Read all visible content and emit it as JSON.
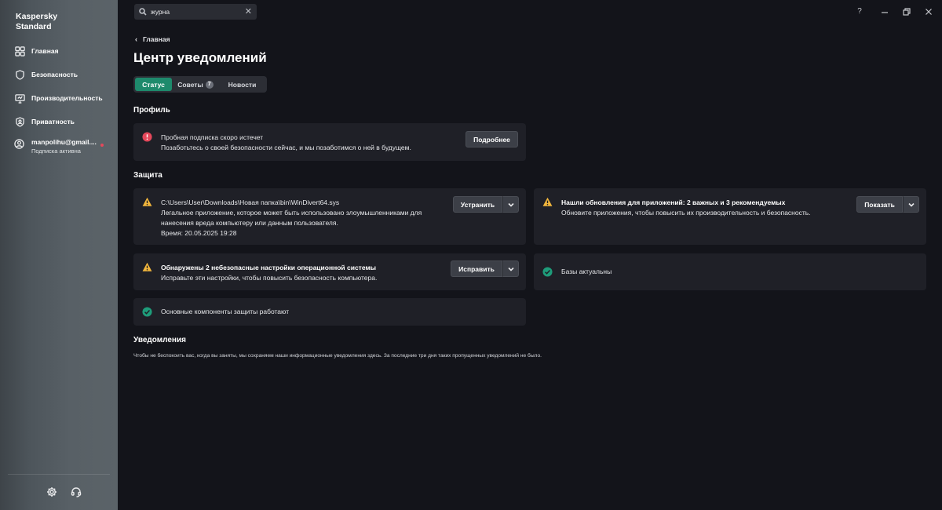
{
  "app": {
    "brand": "Kaspersky\nStandard"
  },
  "sidebar": {
    "items": [
      {
        "label": "Главная",
        "icon": "grid-icon"
      },
      {
        "label": "Безопасность",
        "icon": "shield-icon"
      },
      {
        "label": "Производительность",
        "icon": "monitor-icon"
      },
      {
        "label": "Приватность",
        "icon": "privacy-shield-icon"
      }
    ],
    "account": {
      "email": "manpolihu@gmail....",
      "status": "Подписка активна"
    }
  },
  "search": {
    "value": "журна",
    "placeholder": ""
  },
  "breadcrumb": {
    "label": "Главная"
  },
  "page": {
    "title": "Центр уведомлений"
  },
  "tabs": [
    {
      "label": "Статус",
      "active": true
    },
    {
      "label": "Советы",
      "count": "7"
    },
    {
      "label": "Новости"
    }
  ],
  "sections": {
    "profile": "Профиль",
    "protection": "Защита",
    "notifications": "Уведомления"
  },
  "profile_card": {
    "title": "Пробная подписка скоро истечет",
    "text": "Позаботьтесь о своей безопасности сейчас, и мы позаботимся о ней в будущем.",
    "button": "Подробнее"
  },
  "protection_cards": {
    "windivert": {
      "path": "C:\\Users\\User\\Downloads\\Новая папка\\bin\\WinDivert64.sys",
      "line1": "Легальное приложение, которое может быть использовано злоумышленниками для",
      "line2": "нанесения вреда компьютеру или данным пользователя.",
      "time": "Время: 20.05.2025 19:28",
      "button": "Устранить"
    },
    "updates": {
      "title": "Нашли обновления для приложений: 2 важных и 3 рекомендуемых",
      "text": "Обновите приложения, чтобы повысить их производительность и безопасность.",
      "button": "Показать"
    },
    "os_settings": {
      "title": "Обнаружены 2 небезопасные настройки операционной системы",
      "text": "Исправьте эти настройки, чтобы повысить безопасность компьютера.",
      "button": "Исправить"
    },
    "databases": {
      "text": "Базы актуальны"
    },
    "components": {
      "text": "Основные компоненты защиты работают"
    }
  },
  "notifications_text": "Чтобы не беспокоить вас, когда вы заняты, мы сохраняем наши информационные уведомления здесь. За последние три дня таких пропущенных уведомлений не было.",
  "colors": {
    "accent": "#1e8a6c",
    "error": "#e5485b",
    "warning": "#f2b63c",
    "ok": "#1e9c7a"
  },
  "window_controls": {
    "help": "?"
  }
}
